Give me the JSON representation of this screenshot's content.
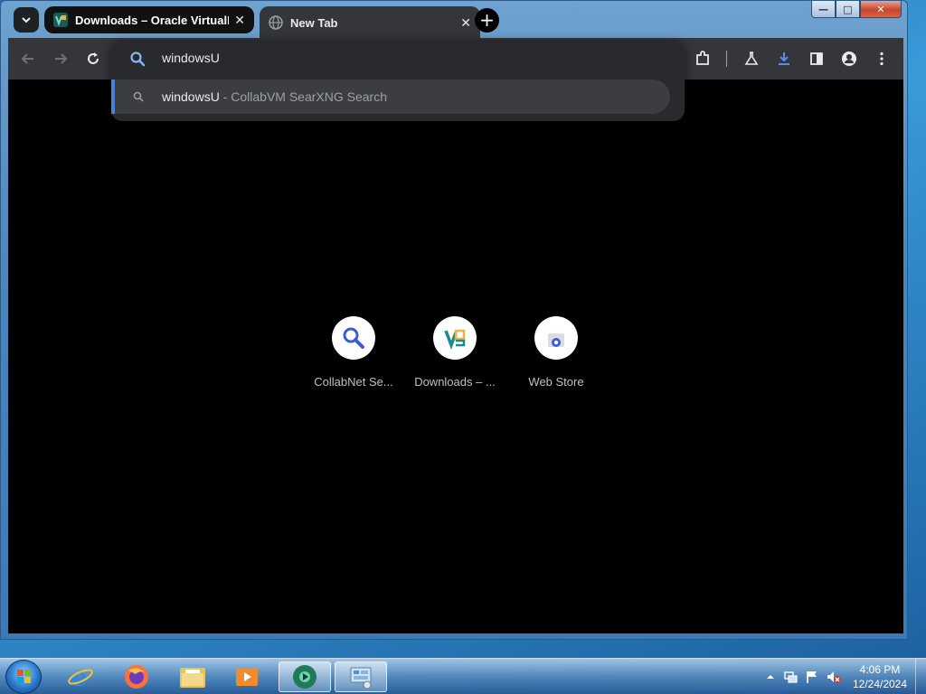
{
  "browser": {
    "tabs": [
      {
        "title": "Downloads – Oracle VirtualBox",
        "close": "✕"
      },
      {
        "title": "New Tab",
        "close": "✕"
      }
    ],
    "new_tab_label": "+",
    "window_controls": {
      "minimize": "—",
      "maximize": "□",
      "close": "✕"
    }
  },
  "omnibox": {
    "text": "windowsU",
    "suggestion": {
      "query": "windowsU",
      "separator": " - ",
      "provider": "CollabVM SearXNG Search"
    }
  },
  "shortcuts": [
    {
      "label": "CollabNet Se...",
      "icon": "search-magnifier-icon"
    },
    {
      "label": "Downloads – ...",
      "icon": "virtualbox-icon"
    },
    {
      "label": "Web Store",
      "icon": "chrome-web-store-icon"
    }
  ],
  "taskbar": {
    "clock_time": "4:06 PM",
    "clock_date": "12/24/2024",
    "apps": [
      "internet-explorer-icon",
      "firefox-icon",
      "file-explorer-icon",
      "media-player-icon",
      "chrome-icon",
      "control-panel-icon"
    ]
  },
  "colors": {
    "accent": "#4a7fd8",
    "toolbar_bg": "#35363a",
    "omnibox_bg": "#282a2d",
    "content_bg": "#000000"
  }
}
